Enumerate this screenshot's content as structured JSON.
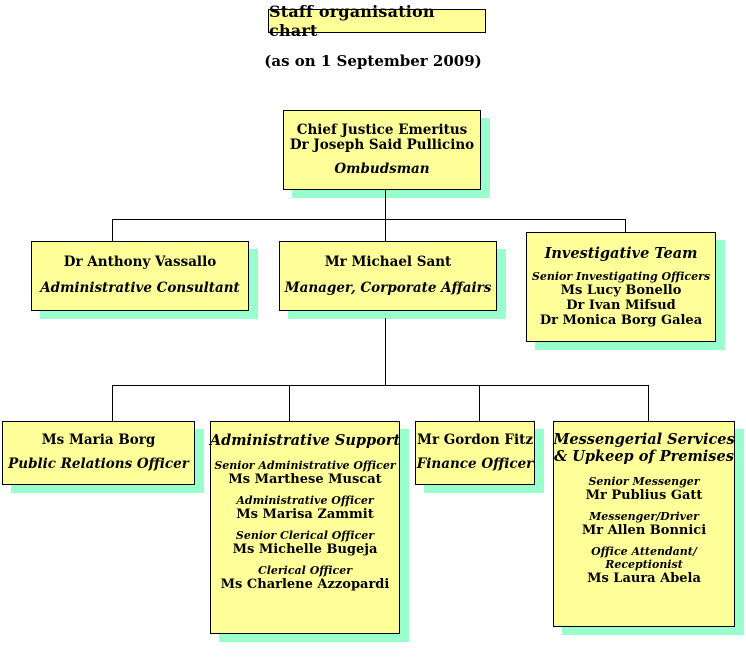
{
  "title": "Staff organisation chart",
  "subtitle": "(as on 1 September 2009)",
  "colors": {
    "box_fill": "#ffff99",
    "box_border": "#000000",
    "shadow": "#99ffcc",
    "text": "#000000",
    "background": "#ffffff"
  },
  "nodes": {
    "ombudsman": {
      "name_line1": "Chief Justice Emeritus",
      "name_line2": "Dr Joseph Said Pullicino",
      "role": "Ombudsman"
    },
    "consultant": {
      "name": "Dr Anthony Vassallo",
      "role": "Administrative Consultant"
    },
    "manager": {
      "name": "Mr Michael Sant",
      "role": "Manager, Corporate Affairs"
    },
    "investigative_team": {
      "heading": "Investigative Team",
      "role_caption": "Senior Investigating Officers",
      "members": [
        "Ms Lucy Bonello",
        "Dr Ivan Mifsud",
        "Dr Monica Borg Galea"
      ]
    },
    "public_relations": {
      "name": "Ms Maria Borg",
      "role": "Public Relations Officer"
    },
    "administrative_support": {
      "heading": "Administrative Support",
      "staff": [
        {
          "title": "Senior Administrative Officer",
          "name": "Ms Marthese Muscat"
        },
        {
          "title": "Administrative Officer",
          "name": "Ms Marisa Zammit"
        },
        {
          "title": "Senior Clerical Officer",
          "name": "Ms Michelle Bugeja"
        },
        {
          "title": "Clerical Officer",
          "name": "Ms Charlene Azzopardi"
        }
      ]
    },
    "finance": {
      "name": "Mr Gordon Fitz",
      "role": "Finance Officer"
    },
    "messengerial": {
      "heading_line1": "Messengerial Services",
      "heading_line2": "& Upkeep of Premises",
      "staff": [
        {
          "title": "Senior Messenger",
          "title2": "",
          "name": "Mr Publius Gatt"
        },
        {
          "title": "Messenger/Driver",
          "title2": "",
          "name": "Mr Allen Bonnici"
        },
        {
          "title": "Office Attendant/",
          "title2": "Receptionist",
          "name": "Ms Laura Abela"
        }
      ]
    }
  }
}
